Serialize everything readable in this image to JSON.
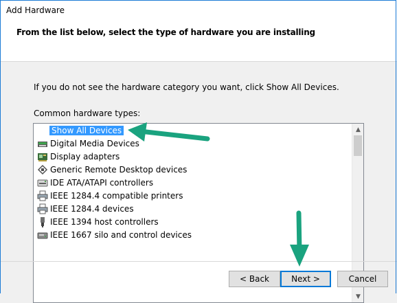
{
  "window": {
    "title": "Add Hardware"
  },
  "header": {
    "title": "From the list below, select the type of hardware you are installing"
  },
  "main": {
    "instruction": "If you do not see the hardware category you want, click Show All Devices.",
    "list_label": "Common hardware types:",
    "items": [
      {
        "label": "Show All Devices",
        "icon": "none",
        "selected": true
      },
      {
        "label": "Digital Media Devices",
        "icon": "media-device-icon"
      },
      {
        "label": "Display adapters",
        "icon": "display-adapter-icon"
      },
      {
        "label": "Generic Remote Desktop devices",
        "icon": "remote-desktop-icon"
      },
      {
        "label": "IDE ATA/ATAPI controllers",
        "icon": "ide-controller-icon"
      },
      {
        "label": "IEEE 1284.4 compatible printers",
        "icon": "printer-icon"
      },
      {
        "label": "IEEE 1284.4 devices",
        "icon": "printer-icon"
      },
      {
        "label": "IEEE 1394 host controllers",
        "icon": "firewire-icon"
      },
      {
        "label": "IEEE 1667 silo and control devices",
        "icon": "storage-icon"
      }
    ]
  },
  "buttons": {
    "back": "< Back",
    "next": "Next >",
    "cancel": "Cancel"
  },
  "colors": {
    "selection": "#3399ff",
    "annotation_arrow": "#1aa37f",
    "accent": "#0078d7"
  }
}
